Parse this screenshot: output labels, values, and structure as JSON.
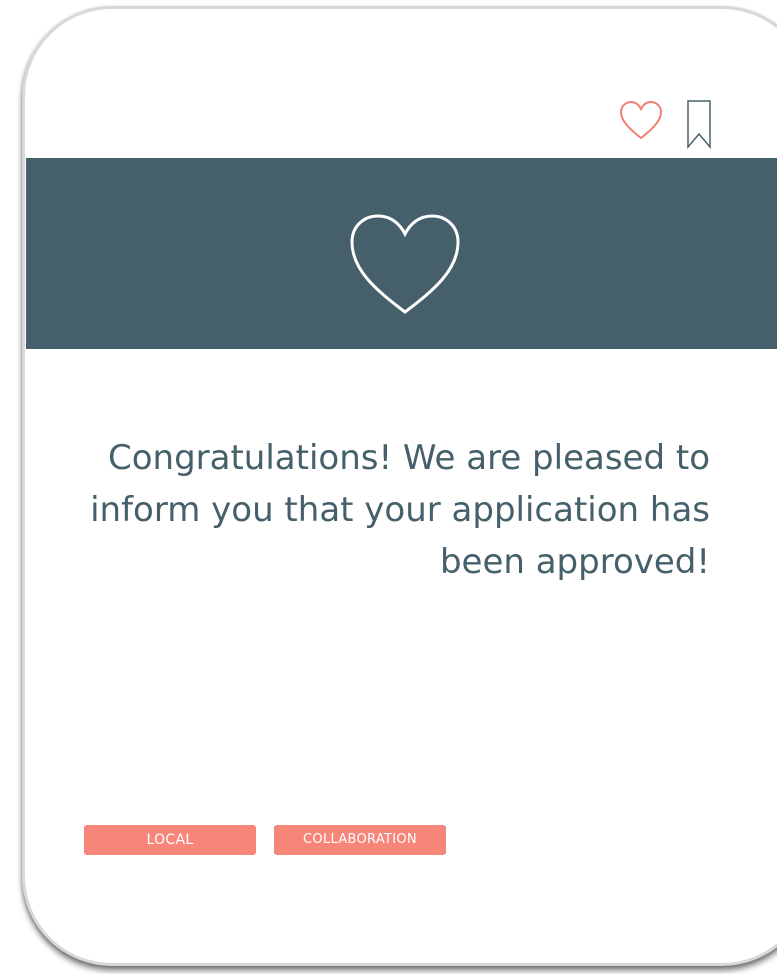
{
  "card": {
    "message": "Congratulations! We are pleased to inform you that your application has been approved!",
    "actions": {
      "like_icon": "heart-outline-icon",
      "save_icon": "bookmark-outline-icon"
    },
    "banner_icon": "heart-outline-icon",
    "tags": [
      {
        "label": "LOCAL"
      },
      {
        "label": "COLLABORATION"
      }
    ]
  },
  "colors": {
    "banner": "#46606b",
    "message_text": "#46606b",
    "tag_background": "#f8857a",
    "tag_text": "#ffffff",
    "like_icon": "#f37f74",
    "bookmark_icon": "#46606b",
    "banner_icon": "#ffffff"
  }
}
